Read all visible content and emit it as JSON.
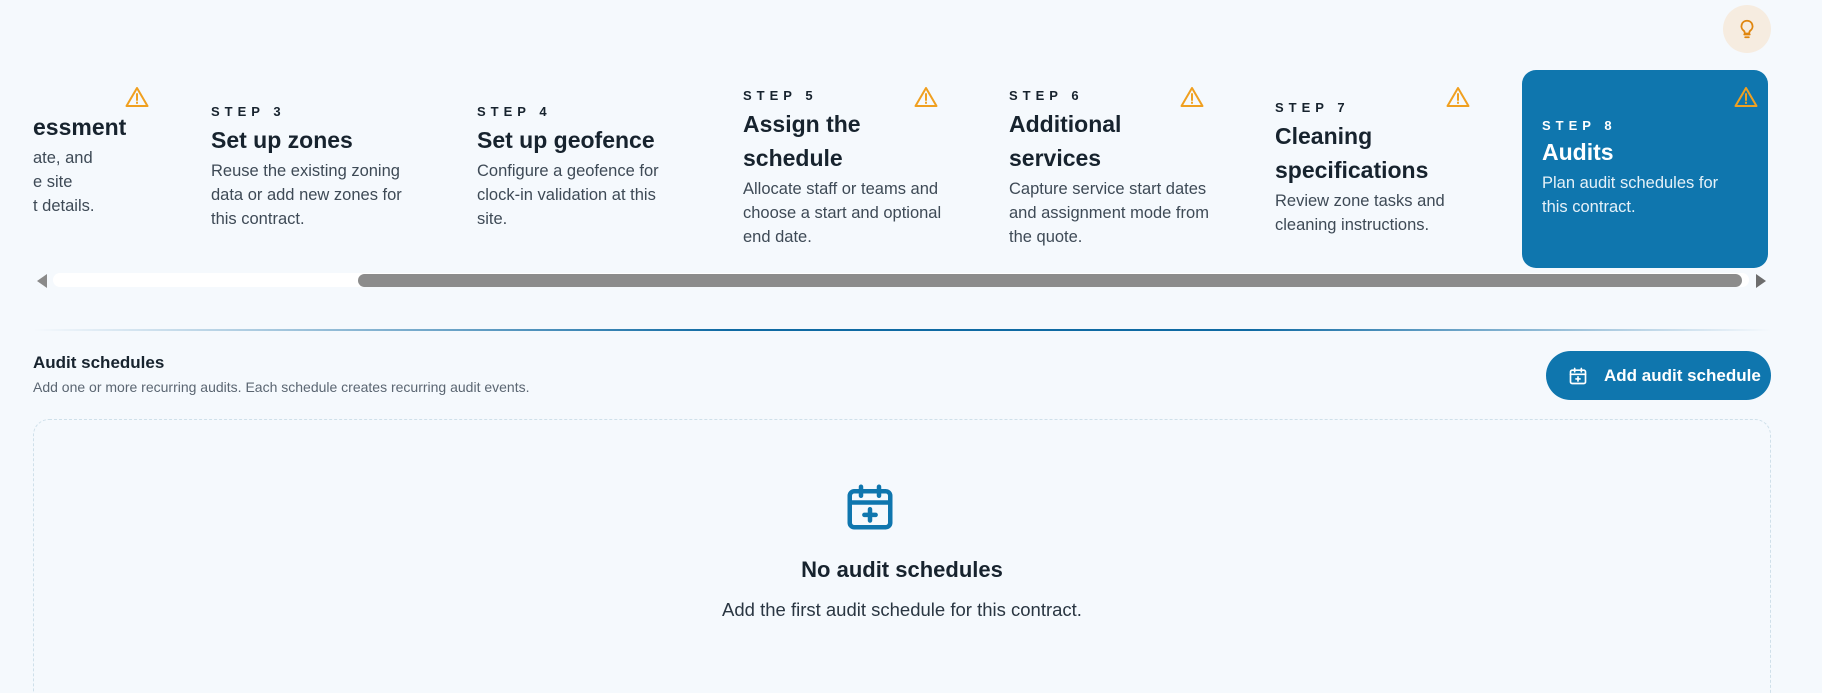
{
  "header": {
    "tip_icon": "lightbulb-icon"
  },
  "steps": [
    {
      "eyebrow": "",
      "title": "essment",
      "desc": "ate, and\ne site\nt details.",
      "warning": true
    },
    {
      "eyebrow": "STEP 3",
      "title": "Set up zones",
      "desc": "Reuse the existing zoning data or add new zones for this contract.",
      "warning": false
    },
    {
      "eyebrow": "STEP 4",
      "title": "Set up geofence",
      "desc": "Configure a geofence for clock-in validation at this site.",
      "warning": false
    },
    {
      "eyebrow": "STEP 5",
      "title": "Assign the schedule",
      "desc": "Allocate staff or teams and choose a start and optional end date.",
      "warning": true
    },
    {
      "eyebrow": "STEP 6",
      "title": "Additional services",
      "desc": "Capture service start dates and assignment mode from the quote.",
      "warning": true
    },
    {
      "eyebrow": "STEP 7",
      "title": "Cleaning specifications",
      "desc": "Review zone tasks and cleaning instructions.",
      "warning": true
    },
    {
      "eyebrow": "STEP 8",
      "title": "Audits",
      "desc": "Plan audit schedules for this contract.",
      "warning": true,
      "active": true
    }
  ],
  "section": {
    "title": "Audit schedules",
    "subtitle": "Add one or more recurring audits. Each schedule creates recurring audit events."
  },
  "actions": {
    "add_label": "Add audit schedule",
    "add_icon": "calendar-plus-icon"
  },
  "empty_state": {
    "icon": "calendar-plus-icon",
    "title": "No audit schedules",
    "message": "Add the first audit schedule for this contract."
  },
  "colors": {
    "accent": "#0f76ae",
    "warning": "#f0a020",
    "tip_bg": "#f6ece0"
  }
}
